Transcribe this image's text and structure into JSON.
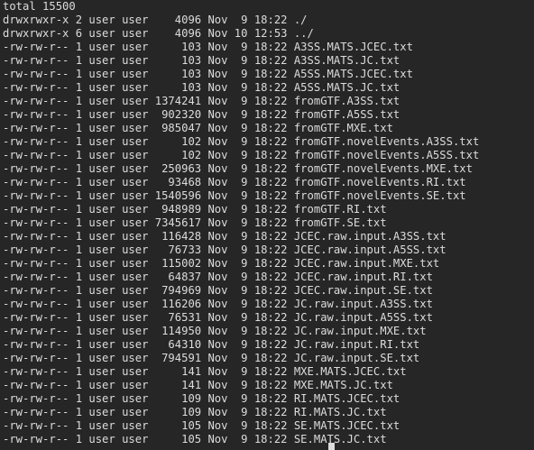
{
  "terminal": {
    "lines": [
      "total 15500",
      "drwxrwxr-x 2 user user    4096 Nov  9 18:22 ./",
      "drwxrwxr-x 6 user user    4096 Nov 10 12:53 ../",
      "-rw-rw-r-- 1 user user     103 Nov  9 18:22 A3SS.MATS.JCEC.txt",
      "-rw-rw-r-- 1 user user     103 Nov  9 18:22 A3SS.MATS.JC.txt",
      "-rw-rw-r-- 1 user user     103 Nov  9 18:22 A5SS.MATS.JCEC.txt",
      "-rw-rw-r-- 1 user user     103 Nov  9 18:22 A5SS.MATS.JC.txt",
      "-rw-rw-r-- 1 user user 1374241 Nov  9 18:22 fromGTF.A3SS.txt",
      "-rw-rw-r-- 1 user user  902320 Nov  9 18:22 fromGTF.A5SS.txt",
      "-rw-rw-r-- 1 user user  985047 Nov  9 18:22 fromGTF.MXE.txt",
      "-rw-rw-r-- 1 user user     102 Nov  9 18:22 fromGTF.novelEvents.A3SS.txt",
      "-rw-rw-r-- 1 user user     102 Nov  9 18:22 fromGTF.novelEvents.A5SS.txt",
      "-rw-rw-r-- 1 user user  250963 Nov  9 18:22 fromGTF.novelEvents.MXE.txt",
      "-rw-rw-r-- 1 user user   93468 Nov  9 18:22 fromGTF.novelEvents.RI.txt",
      "-rw-rw-r-- 1 user user 1540596 Nov  9 18:22 fromGTF.novelEvents.SE.txt",
      "-rw-rw-r-- 1 user user  948989 Nov  9 18:22 fromGTF.RI.txt",
      "-rw-rw-r-- 1 user user 7345617 Nov  9 18:22 fromGTF.SE.txt",
      "-rw-rw-r-- 1 user user  116428 Nov  9 18:22 JCEC.raw.input.A3SS.txt",
      "-rw-rw-r-- 1 user user   76733 Nov  9 18:22 JCEC.raw.input.A5SS.txt",
      "-rw-rw-r-- 1 user user  115002 Nov  9 18:22 JCEC.raw.input.MXE.txt",
      "-rw-rw-r-- 1 user user   64837 Nov  9 18:22 JCEC.raw.input.RI.txt",
      "-rw-rw-r-- 1 user user  794969 Nov  9 18:22 JCEC.raw.input.SE.txt",
      "-rw-rw-r-- 1 user user  116206 Nov  9 18:22 JC.raw.input.A3SS.txt",
      "-rw-rw-r-- 1 user user   76531 Nov  9 18:22 JC.raw.input.A5SS.txt",
      "-rw-rw-r-- 1 user user  114950 Nov  9 18:22 JC.raw.input.MXE.txt",
      "-rw-rw-r-- 1 user user   64310 Nov  9 18:22 JC.raw.input.RI.txt",
      "-rw-rw-r-- 1 user user  794591 Nov  9 18:22 JC.raw.input.SE.txt",
      "-rw-rw-r-- 1 user user     141 Nov  9 18:22 MXE.MATS.JCEC.txt",
      "-rw-rw-r-- 1 user user     141 Nov  9 18:22 MXE.MATS.JC.txt",
      "-rw-rw-r-- 1 user user     109 Nov  9 18:22 RI.MATS.JCEC.txt",
      "-rw-rw-r-- 1 user user     109 Nov  9 18:22 RI.MATS.JC.txt",
      "-rw-rw-r-- 1 user user     105 Nov  9 18:22 SE.MATS.JCEC.txt",
      "-rw-rw-r-- 1 user user     105 Nov  9 18:22 SE.MATS.JC.txt"
    ],
    "colors": {
      "background": "#262626",
      "foreground": "#dcdcdc"
    }
  }
}
